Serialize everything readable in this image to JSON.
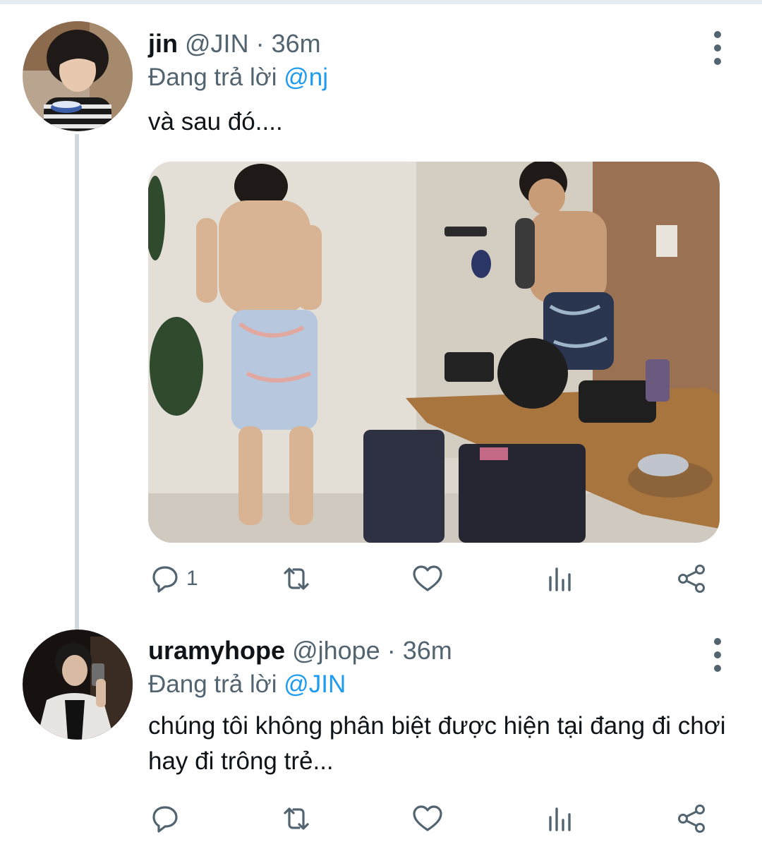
{
  "tweets": [
    {
      "name": "jin",
      "handle": "@JIN",
      "separator": "·",
      "time": "36m",
      "replying_prefix": "Đang trả lời",
      "replying_to": "@nj",
      "text": "và sau đó....",
      "reply_count": "1",
      "retweet_count": "",
      "like_count": ""
    },
    {
      "name": "uramyhope",
      "handle": "@jhope",
      "separator": "·",
      "time": "36m",
      "replying_prefix": "Đang trả lời",
      "replying_to": "@JIN",
      "text": "chúng tôi không phân biệt được hiện tại đang đi chơi hay đi trông trẻ...",
      "reply_count": "",
      "retweet_count": "",
      "like_count": ""
    }
  ],
  "icons": {
    "reply": "reply-icon",
    "retweet": "retweet-icon",
    "like": "heart-icon",
    "stats": "analytics-icon",
    "share": "share-icon",
    "more": "more-vertical-icon"
  },
  "colors": {
    "link": "#1d9bf0",
    "secondary_text": "#536471",
    "thread_line": "#cfd9de"
  }
}
